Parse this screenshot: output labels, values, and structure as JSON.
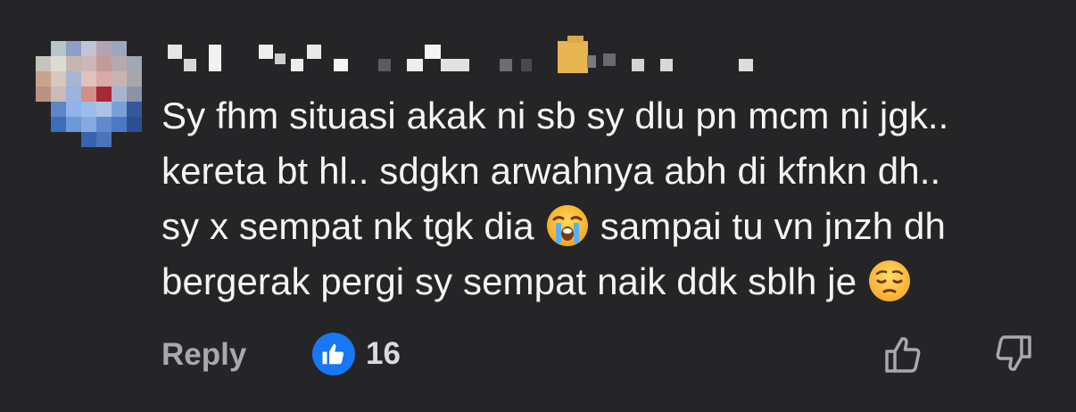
{
  "comment": {
    "lines": [
      "Sy fhm situasi akak ni sb sy dlu pn mcm ni jgk..",
      "kereta bt hl.. sdgkn arwahnya abh di kfnkn dh..",
      "sy x sempat nk tgk dia",
      "sampai tu vn jnzh dh",
      "bergerak pergi sy sempat naik ddk sblh je"
    ]
  },
  "actions": {
    "reply_label": "Reply",
    "reaction_count": "16",
    "reaction_icon": "like-icon",
    "upvote_icon": "thumbs-up-outline-icon",
    "downvote_icon": "thumbs-down-outline-icon"
  },
  "emojis": [
    "loudly-crying-face",
    "pensive-face"
  ],
  "colors": {
    "background": "#252527",
    "text": "#f5f5f5",
    "muted": "#a7a9ad",
    "like_blue": "#1877f2"
  }
}
